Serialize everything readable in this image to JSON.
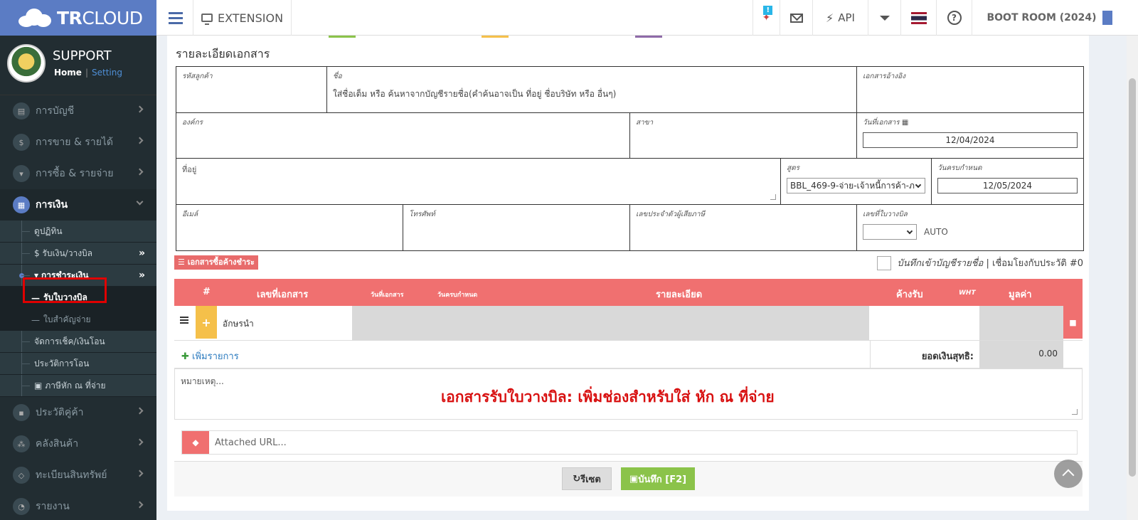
{
  "topbar": {
    "brand_bold": "TR",
    "brand_rest": "CLOUD",
    "extension_label": "EXTENSION",
    "notify_badge": "!",
    "api_label": "API",
    "company_label": "BOOT ROOM (2024)"
  },
  "user": {
    "name": "SUPPORT",
    "home": "Home",
    "separator": "|",
    "setting": "Setting"
  },
  "sidebar": {
    "menu_top": [
      {
        "label": "การบัญชี",
        "icon": "book-icon"
      },
      {
        "label": "การขาย & รายได้",
        "icon": "dollar-icon"
      },
      {
        "label": "การซื้อ & รายจ่าย",
        "icon": "cart-icon"
      }
    ],
    "active_menu": {
      "label": "การเงิน",
      "icon": "calendar-icon"
    },
    "sub_items": [
      {
        "label": "ดูปฏิทิน"
      },
      {
        "label": "$ รับเงิน/วางบิล"
      }
    ],
    "open_sub": {
      "label": "การชำระเงิน"
    },
    "subsub_items": [
      {
        "label": "รับใบวางบิล"
      },
      {
        "label": "ใบสำคัญจ่าย"
      }
    ],
    "sub_items_after": [
      {
        "label": "จัดการเช็ค/เงินโอน"
      },
      {
        "label": "ประวัติการโอน"
      },
      {
        "label": "ภาษีหัก ณ ที่จ่าย"
      }
    ],
    "menu_bottom": [
      {
        "label": "ประวัติคู่ค้า",
        "icon": "contact-icon"
      },
      {
        "label": "คลังสินค้า",
        "icon": "boxes-icon"
      },
      {
        "label": "ทะเบียนสินทรัพย์",
        "icon": "diamond-icon"
      },
      {
        "label": "รายงาน",
        "icon": "report-icon"
      }
    ]
  },
  "form": {
    "title": "รายละเอียดเอกสาร",
    "customer_code_label": "รหัสลูกค้า",
    "name_label": "ชื่อ",
    "name_placeholder": "ใส่ชื่อเต็ม หรือ ค้นหาจากบัญชีรายชื่อ(คำค้นอาจเป็น ที่อยู่ ชื่อบริษัท หรือ อื่นๆ)",
    "ref_doc_label": "เอกสารอ้างอิง",
    "org_label": "องค์กร",
    "branch_label": "สาขา",
    "doc_date_label": "วันที่เอกสาร",
    "doc_date": "12/04/2024",
    "address_label": "ที่อยู่",
    "formula_label": "สูตร",
    "formula_value": "BBL_469-9-จ่าย-เจ้าหนี้การค้า-ภ",
    "due_date_label": "วันครบกำหนด",
    "due_date": "12/05/2024",
    "email_label": "อีเมล์",
    "phone_label": "โทรศัพท์",
    "tax_id_label": "เลขประจำตัวผู้เสียภาษี",
    "bill_no_label": "เลขที่ใบวางบิล",
    "bill_no_auto": "AUTO"
  },
  "pending": {
    "button_label": "เอกสารซื้อค้างชำระ",
    "checkbox_label": "บันทึกเข้าบัญชีรายชื่อ",
    "link_text": "| เชื่อมโยงกับประวัติ #0"
  },
  "table": {
    "headers": {
      "hash": "#",
      "doc_no": "เลขที่เอกสาร",
      "doc_date": "วันที่เอกสาร",
      "due_date": "วันครบกำหนด",
      "detail": "รายละเอียด",
      "outstanding": "ค้างรับ",
      "wht": "WHT",
      "amount": "มูลค่า"
    },
    "row_prefix": "อักษรนำ",
    "add_line": "เพิ่มรายการ",
    "net_label": "ยอดเงินสุทธิ:",
    "net_value": "0.00"
  },
  "note_placeholder": "หมายเหตุ...",
  "banner": "เอกสารรับใบวางบิล: เพิ่มช่องสำหรับใส่ หัก ณ ที่จ่าย",
  "url_placeholder": "Attached URL...",
  "buttons": {
    "reset": "รีเซต",
    "save": "บันทึก [F2]"
  },
  "colors": {
    "brand": "#5b7cc4",
    "header_red": "#f07070",
    "save_green": "#8bc34a",
    "banner_red": "#d81010"
  }
}
